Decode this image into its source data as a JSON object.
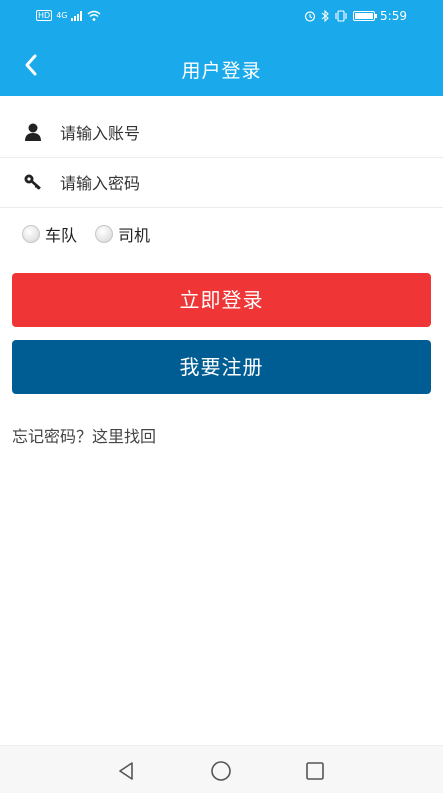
{
  "status_bar": {
    "hd": "HD",
    "network": "4G",
    "time": "5:59"
  },
  "header": {
    "title": "用户登录",
    "back_icon": "chevron-left-icon"
  },
  "form": {
    "account": {
      "placeholder": "请输入账号",
      "value": "",
      "icon": "user-icon"
    },
    "password": {
      "placeholder": "请输入密码",
      "value": "",
      "icon": "key-icon"
    }
  },
  "roles": {
    "options": [
      {
        "label": "车队",
        "selected": false
      },
      {
        "label": "司机",
        "selected": false
      }
    ]
  },
  "actions": {
    "login_label": "立即登录",
    "register_label": "我要注册",
    "forgot_label": "忘记密码？这里找回"
  },
  "colors": {
    "header_bg": "#1aa9ea",
    "login_button": "#ef3535",
    "register_button": "#005d93"
  }
}
